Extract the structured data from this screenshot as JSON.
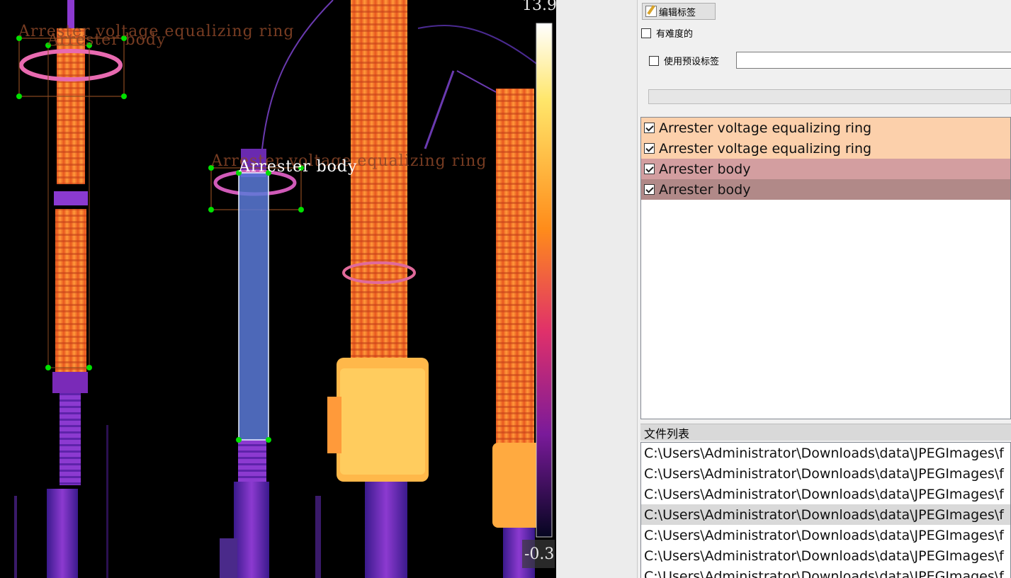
{
  "canvas": {
    "scale_max": "13.9",
    "scale_min": "-0.3",
    "annotation_labels": [
      "Arrester voltage equalizing ring",
      "Arrester body",
      "Arrester voltage equalizing ring",
      "Arrester body"
    ]
  },
  "toolbar": {
    "edit_label_button": "编辑标签",
    "difficult_checkbox": "有难度的",
    "preset_label_checkbox": "使用预设标签",
    "preset_label_value": ""
  },
  "label_list": [
    {
      "label": "Arrester voltage equalizing ring",
      "color": "#fcd0ab",
      "checked": true
    },
    {
      "label": "Arrester voltage equalizing ring",
      "color": "#fcd0ab",
      "checked": true
    },
    {
      "label": "Arrester body",
      "color": "#d39ea0",
      "checked": true
    },
    {
      "label": "Arrester body",
      "color": "#b18988",
      "checked": true
    }
  ],
  "file_list": {
    "title": "文件列表",
    "items": [
      "C:\\Users\\Administrator\\Downloads\\data\\JPEGImages\\f",
      "C:\\Users\\Administrator\\Downloads\\data\\JPEGImages\\f",
      "C:\\Users\\Administrator\\Downloads\\data\\JPEGImages\\f",
      "C:\\Users\\Administrator\\Downloads\\data\\JPEGImages\\f",
      "C:\\Users\\Administrator\\Downloads\\data\\JPEGImages\\f",
      "C:\\Users\\Administrator\\Downloads\\data\\JPEGImages\\f",
      "C:\\Users\\Administrator\\Downloads\\data\\JPEGImages\\f"
    ],
    "selected_index": 3
  }
}
